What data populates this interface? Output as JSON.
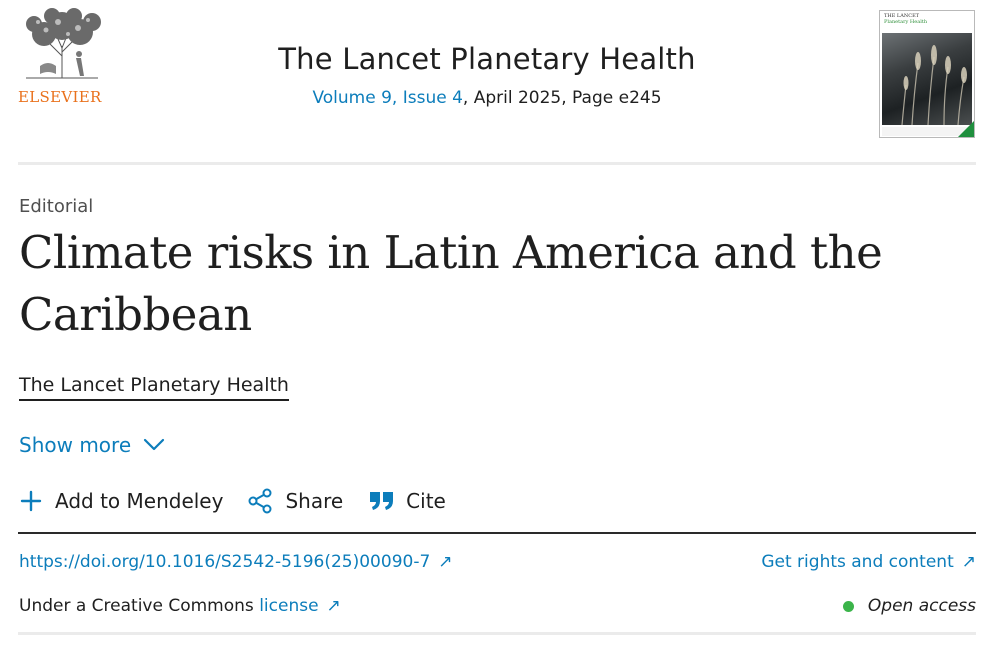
{
  "header": {
    "publisher_logo_text": "ELSEVIER",
    "journal_title": "The Lancet Planetary Health",
    "volume_issue": "Volume 9, Issue 4",
    "issue_rest": ", April 2025, Page e245",
    "cover_title": "THE LANCET",
    "cover_subtitle": "Planetary Health"
  },
  "article": {
    "type": "Editorial",
    "title": "Climate risks in Latin America and the Caribbean",
    "author": "The Lancet Planetary Health",
    "show_more": "Show more"
  },
  "toolbar": {
    "add_label": "Add to Mendeley",
    "share_label": "Share",
    "cite_label": "Cite"
  },
  "links": {
    "doi": "https://doi.org/10.1016/S2542-5196(25)00090-7",
    "rights": "Get rights and content",
    "license_prefix": "Under a Creative Commons ",
    "license_link": "license",
    "open_access": "Open access",
    "external_arrow": "↗"
  },
  "colors": {
    "link_blue": "#0c7dbb",
    "elsevier_orange": "#e9711c",
    "open_access_green": "#3bb44a"
  },
  "icons": [
    "elsevier-tree-logo",
    "chevron-down-icon",
    "plus-icon",
    "share-icon",
    "quote-icon",
    "external-link-icon",
    "open-access-dot-icon"
  ]
}
